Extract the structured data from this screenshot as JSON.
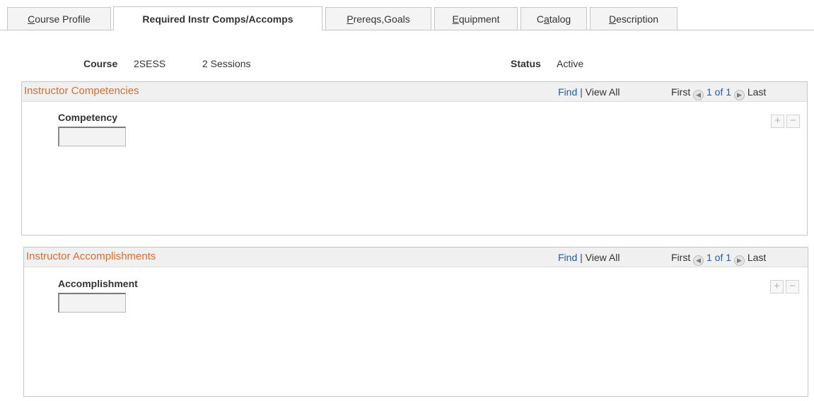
{
  "tabs": [
    {
      "pre": "",
      "key": "C",
      "post": "ourse Profile",
      "active": false
    },
    {
      "pre": "",
      "key": "",
      "post": "Required Instr Comps/Accomps",
      "active": true
    },
    {
      "pre": "",
      "key": "P",
      "post": "rereqs,Goals",
      "active": false
    },
    {
      "pre": "",
      "key": "E",
      "post": "quipment",
      "active": false
    },
    {
      "pre": "C",
      "key": "a",
      "post": "talog",
      "active": false
    },
    {
      "pre": "",
      "key": "D",
      "post": "escription",
      "active": false
    }
  ],
  "header": {
    "course_label": "Course",
    "course_code": "2SESS",
    "course_name": "2 Sessions",
    "status_label": "Status",
    "status_value": "Active"
  },
  "competencies": {
    "title": "Instructor Competencies",
    "find": "Find",
    "sep": "|",
    "view_all": "View All",
    "first": "First",
    "range": "1 of 1",
    "last": "Last",
    "column": "Competency",
    "value": "",
    "add": "+",
    "remove": "−"
  },
  "accomplishments": {
    "title": "Instructor Accomplishments",
    "find": "Find",
    "sep": "|",
    "view_all": "View All",
    "first": "First",
    "range": "1 of 1",
    "last": "Last",
    "column": "Accomplishment",
    "value": "",
    "add": "+",
    "remove": "−"
  },
  "colors": {
    "group_title": "#cc6f35",
    "link": "#1f5ca8",
    "tab_border": "#c6c6c6"
  }
}
